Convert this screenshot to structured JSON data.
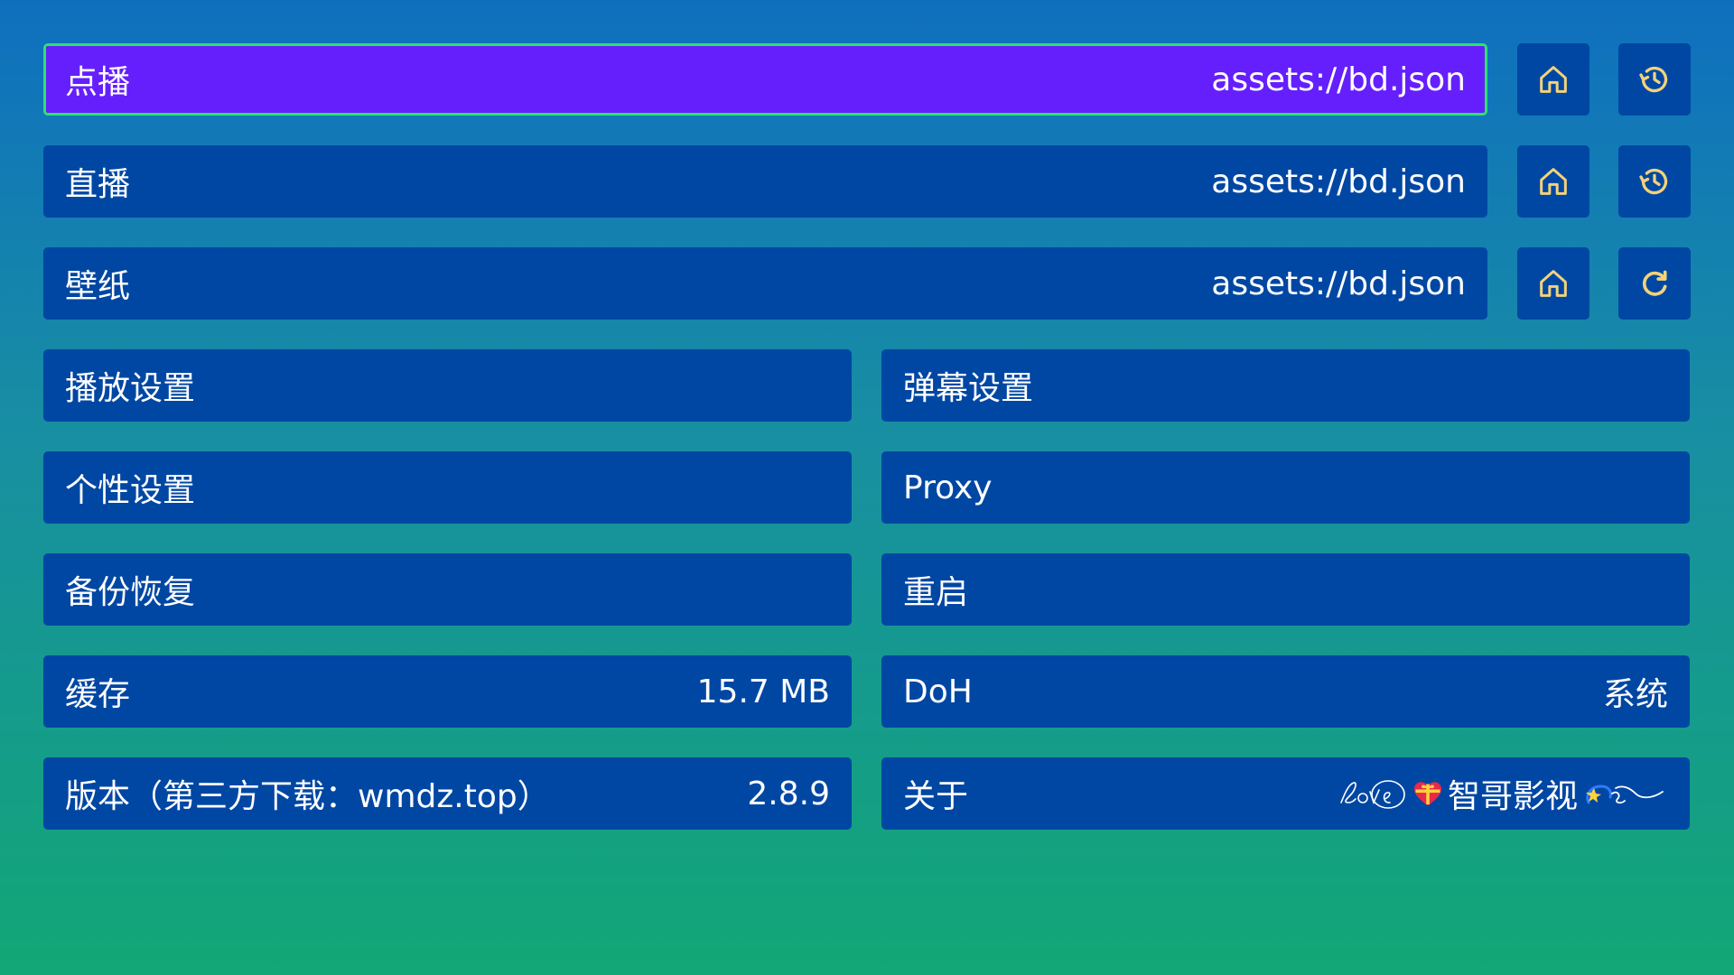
{
  "sources": [
    {
      "label": "点播",
      "value": "assets://bd.json",
      "focused": true,
      "action_icon": "history-icon"
    },
    {
      "label": "直播",
      "value": "assets://bd.json",
      "focused": false,
      "action_icon": "history-icon"
    },
    {
      "label": "壁纸",
      "value": "assets://bd.json",
      "focused": false,
      "action_icon": "refresh-icon"
    }
  ],
  "settings": {
    "play": "播放设置",
    "danmaku": "弹幕设置",
    "personal": "个性设置",
    "proxy": "Proxy",
    "backup": "备份恢复",
    "restart": "重启",
    "cache_label": "缓存",
    "cache_value": "15.7 MB",
    "doh_label": "DoH",
    "doh_value": "系统",
    "version_label": "版本（第三方下载：wmdz.top）",
    "version_value": "2.8.9",
    "about_label": "关于",
    "about_value": "智哥影视"
  },
  "colors": {
    "button_bg": "#0047a3",
    "focused_bg": "#651ffd",
    "focus_border": "#2ee26a",
    "icon": "#f2d27a"
  }
}
